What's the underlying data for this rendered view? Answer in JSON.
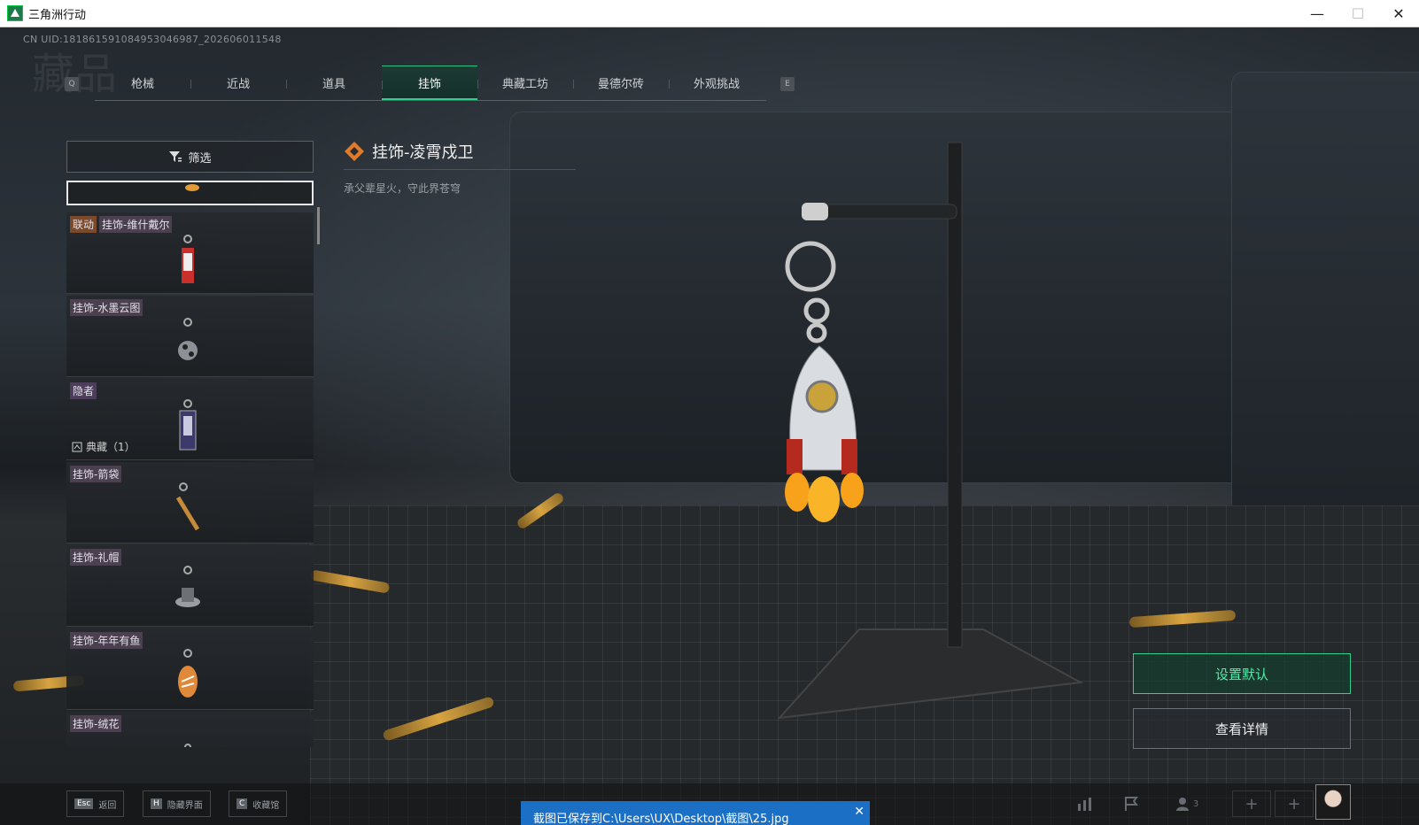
{
  "window": {
    "title": "三角洲行动",
    "minimize": "—",
    "maximize": "☐",
    "close": "✕"
  },
  "uid": "CN UID:1818615910849530469​87_202606011548",
  "bg_title": "藏品",
  "tabs": {
    "prev_key": "Q",
    "next_key": "E",
    "items": [
      "枪械",
      "近战",
      "道具",
      "挂饰",
      "典藏工坊",
      "曼德尔砖",
      "外观挑战"
    ],
    "active_index": 3
  },
  "filter": {
    "label": "筛选"
  },
  "list": [
    {
      "tags": [
        "联动",
        "挂饰-维什戴尔"
      ]
    },
    {
      "tags": [
        "挂饰-水墨云图"
      ]
    },
    {
      "tags": [
        "隐者"
      ],
      "sub": "典藏（1）"
    },
    {
      "tags": [
        "挂饰-箭袋"
      ]
    },
    {
      "tags": [
        "挂饰-礼帽"
      ]
    },
    {
      "tags": [
        "挂饰-年年有鱼"
      ]
    },
    {
      "tags": [
        "挂饰-绒花"
      ]
    }
  ],
  "detail": {
    "title": "挂饰-凌霄戍卫",
    "desc": "承父辈星火，守此界苍穹"
  },
  "actions": {
    "set_default": "设置默认",
    "view_details": "查看详情"
  },
  "hints": [
    {
      "key": "Esc",
      "label": "返回"
    },
    {
      "key": "H",
      "label": "隐藏界面"
    },
    {
      "key": "C",
      "label": "收藏馆"
    }
  ],
  "friends_count": "3",
  "toast": {
    "text": "截图已保存到C:\\Users\\UX\\Desktop\\截图\\25.jpg",
    "close": "✕"
  },
  "colors": {
    "accent": "#2fd08b",
    "toast": "#1b6fc4"
  }
}
